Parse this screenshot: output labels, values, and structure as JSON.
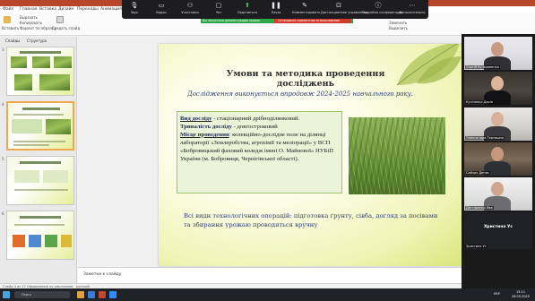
{
  "ppt_tabs": [
    "Файл",
    "Главная",
    "Вставка",
    "Дизайн",
    "Переходы",
    "Анимация"
  ],
  "ribbon": {
    "paste_label": "Вставить",
    "cut_label": "Вырезать",
    "copy_label": "Копировать",
    "format_label": "Формат по образцу",
    "create_slide_label": "Создать слайд",
    "find_label": "Найти",
    "replace_label": "Заменить",
    "select_label": "Выделить"
  },
  "zoom_toolbar": {
    "items": [
      {
        "label": "Звук",
        "icon": "microphone-icon"
      },
      {
        "label": "Видео",
        "icon": "camera-icon"
      },
      {
        "label": "Участники",
        "icon": "people-icon"
      },
      {
        "label": "Чат",
        "icon": "chat-icon"
      },
      {
        "label": "Поделиться",
        "icon": "share-icon"
      },
      {
        "label": "Пауза",
        "icon": "pause-icon"
      },
      {
        "label": "Комментировать",
        "icon": "pen-icon"
      },
      {
        "label": "Дистанционное управление",
        "icon": "remote-icon"
      },
      {
        "label": "Подробно конференции",
        "icon": "info-icon"
      },
      {
        "label": "Дополнительно",
        "icon": "more-icon"
      }
    ],
    "banner_left": "Вы запустили демонстрацию экрана",
    "banner_right": "Остановить совместное использование"
  },
  "slides_panel": {
    "tab_slides": "Слайды",
    "tab_outline": "Структура",
    "numbers": [
      "3",
      "4",
      "5",
      "6"
    ]
  },
  "slide": {
    "title": "Умови та методика проведення досліджень",
    "period": "Дослідження виконується впродовж 2024-2025 навчального року.",
    "info": {
      "type_label": "Вид досліду",
      "type_value": " - стаціонарний дрібноділянковий.",
      "duration_label": "Тривалість досліду",
      "duration_value": " - довгостроковий",
      "place_label": "Місце проведення",
      "place_value": ": колекційно-дослідне поле на ділянці лабораторії «Землеробства, агрохімії та меліорації» у ВСП «Бобровицький фаховий коледж імені О. Майнової» НУБіП України (м. Бобровиця, Чернігівської області)."
    },
    "footer": "Всі види технологічних операцій: підготовка ґрунту, сівба, догляд за посівами та збирання урожаю проводяться вручну"
  },
  "notes_placeholder": "Заметки к слайду",
  "status": {
    "slide_info": "Слайд 4 из 17",
    "theme": "Оформление по умолчанию",
    "lang": "русский"
  },
  "participants": [
    {
      "name": "Сергій Кучерявенко",
      "kind": "video"
    },
    {
      "name": "Куліченко Дарія",
      "kind": "video"
    },
    {
      "name": "Олександра Тертишна",
      "kind": "video"
    },
    {
      "name": "Сайчик Денис",
      "kind": "video"
    },
    {
      "name": "Дегтяренко Ива",
      "kind": "video"
    },
    {
      "name": "Христина Ус",
      "kind": "avatar"
    }
  ],
  "taskbar": {
    "search_placeholder": "Поиск",
    "lang": "УКР",
    "time": "13:11",
    "date": "28.05.2025"
  }
}
